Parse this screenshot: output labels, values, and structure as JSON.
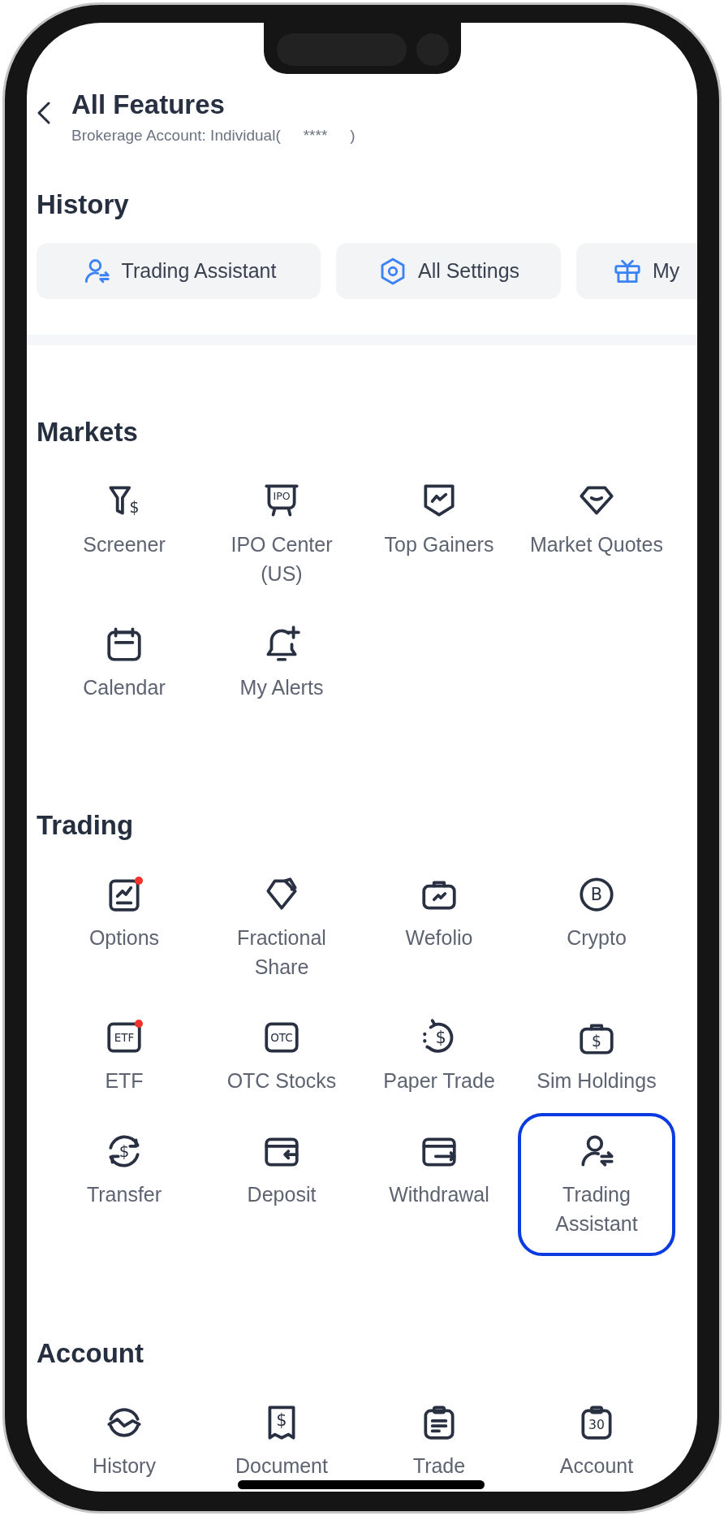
{
  "header": {
    "title": "All Features",
    "subtitle_prefix": "Brokerage Account: Individual(",
    "masked_number": "****",
    "subtitle_suffix": ")"
  },
  "history": {
    "title": "History",
    "chips": [
      {
        "label": "Trading Assistant"
      },
      {
        "label": "All Settings"
      },
      {
        "label": "My"
      }
    ]
  },
  "sections": [
    {
      "title": "Markets",
      "items": [
        {
          "label": "Screener",
          "icon_text": "$",
          "dot": false,
          "selected": false
        },
        {
          "label": "IPO Center (US)",
          "icon_text": "IPO",
          "dot": false,
          "selected": false
        },
        {
          "label": "Top Gainers",
          "dot": false,
          "selected": false
        },
        {
          "label": "Market Quotes",
          "dot": false,
          "selected": false
        },
        {
          "label": "Calendar",
          "dot": false,
          "selected": false
        },
        {
          "label": "My Alerts",
          "dot": false,
          "selected": false
        }
      ]
    },
    {
      "title": "Trading",
      "items": [
        {
          "label": "Options",
          "dot": true,
          "selected": false
        },
        {
          "label": "Fractional Share",
          "dot": false,
          "selected": false
        },
        {
          "label": "Wefolio",
          "dot": false,
          "selected": false
        },
        {
          "label": "Crypto",
          "icon_text": "B",
          "dot": false,
          "selected": false
        },
        {
          "label": "ETF",
          "icon_text": "ETF",
          "dot": true,
          "selected": false
        },
        {
          "label": "OTC Stocks",
          "icon_text": "OTC",
          "dot": false,
          "selected": false
        },
        {
          "label": "Paper Trade",
          "icon_text": "$",
          "dot": false,
          "selected": false
        },
        {
          "label": "Sim Holdings",
          "icon_text": "$",
          "dot": false,
          "selected": false
        },
        {
          "label": "Transfer",
          "icon_text": "$",
          "dot": false,
          "selected": false
        },
        {
          "label": "Deposit",
          "dot": false,
          "selected": false
        },
        {
          "label": "Withdrawal",
          "dot": false,
          "selected": false
        },
        {
          "label": "Trading Assistant",
          "dot": false,
          "selected": true
        }
      ]
    },
    {
      "title": "Account",
      "items": [
        {
          "label": "History",
          "dot": false,
          "selected": false
        },
        {
          "label": "Document",
          "icon_text": "$",
          "dot": false,
          "selected": false
        },
        {
          "label": "Trade",
          "dot": false,
          "selected": false
        },
        {
          "label": "Account",
          "icon_text": "30",
          "dot": false,
          "selected": false
        }
      ]
    }
  ]
}
